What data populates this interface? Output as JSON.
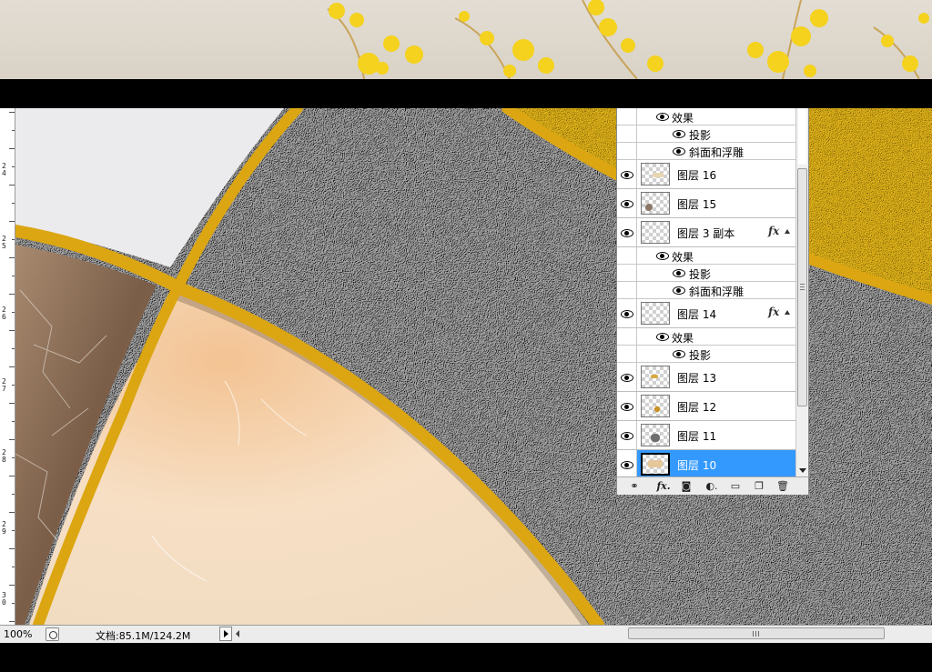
{
  "app": {
    "accent_selected": "#3399ff",
    "frame_color": "#dba612"
  },
  "ruler": {
    "labels": [
      {
        "text": "2\n4"
      },
      {
        "text": "2\n5"
      },
      {
        "text": "2\n6"
      },
      {
        "text": "2\n7"
      },
      {
        "text": "2\n8"
      },
      {
        "text": "2\n9"
      },
      {
        "text": "3\n0"
      }
    ]
  },
  "layers": {
    "rows": [
      {
        "type": "effect",
        "level": 1,
        "label": "效果"
      },
      {
        "type": "effect",
        "level": 2,
        "label": "投影"
      },
      {
        "type": "effect",
        "level": 2,
        "label": "斜面和浮雕"
      },
      {
        "type": "layer",
        "name": "图层 16",
        "fx": false,
        "selected": false,
        "thumb_mark_color": "#e8d6b0"
      },
      {
        "type": "layer",
        "name": "图层 15",
        "fx": false,
        "selected": false,
        "thumb_mark_color": "#8a7767"
      },
      {
        "type": "layer",
        "name": "图层 3 副本",
        "fx": true,
        "fx_label": "fx",
        "selected": false,
        "thumb_mark_color": ""
      },
      {
        "type": "effect",
        "level": 1,
        "label": "效果"
      },
      {
        "type": "effect",
        "level": 2,
        "label": "投影"
      },
      {
        "type": "effect",
        "level": 2,
        "label": "斜面和浮雕"
      },
      {
        "type": "layer",
        "name": "图层 14",
        "fx": true,
        "fx_label": "fx",
        "selected": false,
        "thumb_mark_color": ""
      },
      {
        "type": "effect",
        "level": 1,
        "label": "效果"
      },
      {
        "type": "effect",
        "level": 2,
        "label": "投影"
      },
      {
        "type": "layer",
        "name": "图层 13",
        "fx": false,
        "selected": false,
        "thumb_mark_color": "#d8a840"
      },
      {
        "type": "layer",
        "name": "图层 12",
        "fx": false,
        "selected": false,
        "thumb_mark_color": "#c8922a"
      },
      {
        "type": "layer",
        "name": "图层 11",
        "fx": false,
        "selected": false,
        "thumb_mark_color": "#6e6e6e"
      },
      {
        "type": "layer",
        "name": "图层 10",
        "fx": false,
        "selected": true,
        "thumb_mark_color": "#e6c79a"
      }
    ],
    "toolbar_buttons": [
      {
        "name": "link-layers-button",
        "glyph": "⚭"
      },
      {
        "name": "add-style-button",
        "glyph": "fx."
      },
      {
        "name": "add-mask-button",
        "glyph": "◙"
      },
      {
        "name": "adjustment-layer-button",
        "glyph": "◐."
      },
      {
        "name": "new-group-button",
        "glyph": "▭"
      },
      {
        "name": "new-layer-button",
        "glyph": "❐"
      },
      {
        "name": "delete-layer-button",
        "glyph": "🗑"
      }
    ]
  },
  "status": {
    "zoom": "100%",
    "doc_info": "文档:85.1M/124.2M"
  }
}
